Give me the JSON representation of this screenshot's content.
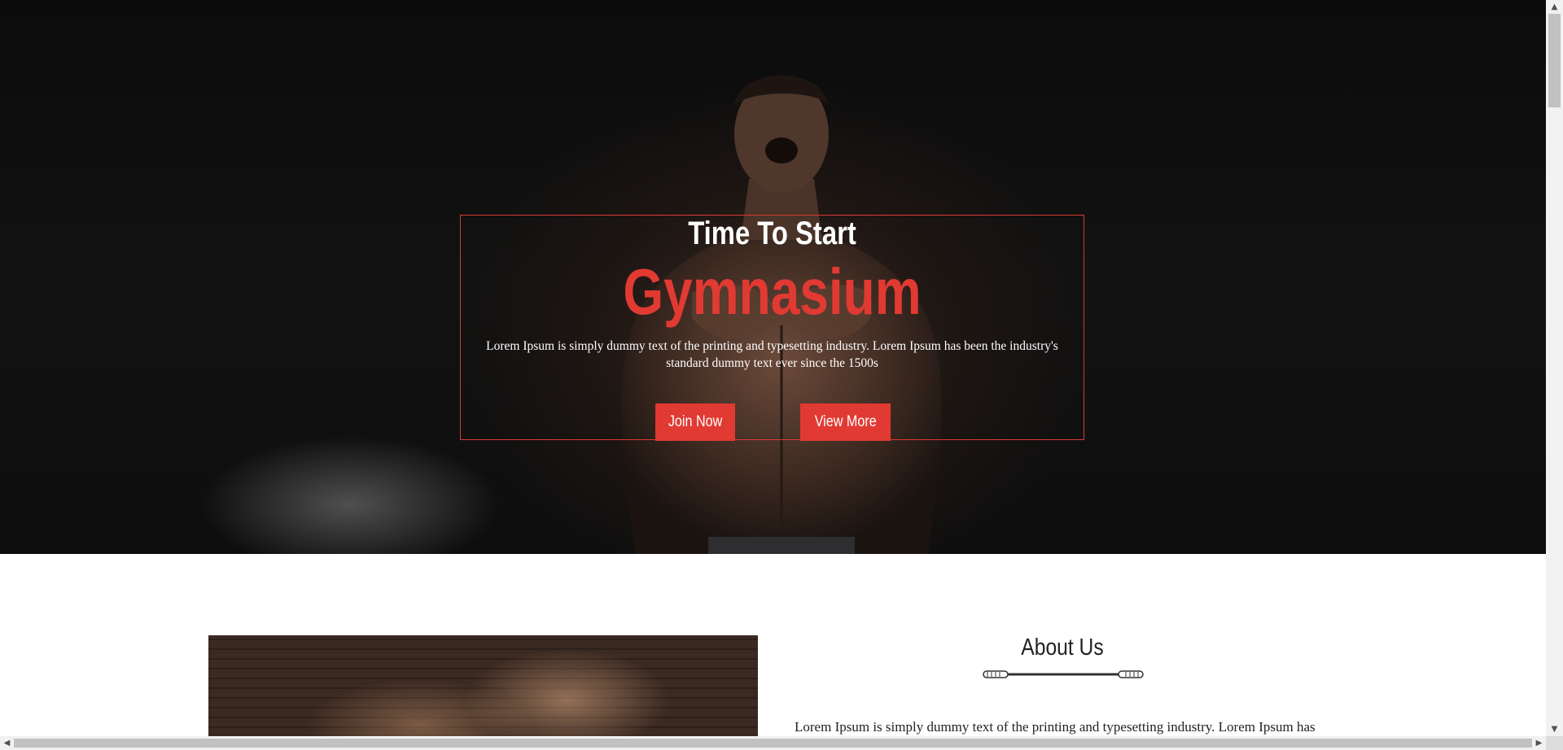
{
  "hero": {
    "pretitle": "Time To Start",
    "title": "Gymnasium",
    "text": "Lorem Ipsum is simply dummy text of the printing and typesetting industry. Lorem Ipsum has been the industry's standard dummy text ever since the 1500s",
    "buttons": {
      "join": "Join Now",
      "view": "View More"
    },
    "image": "muscular-man-shouting-icon"
  },
  "about": {
    "heading": "About Us",
    "divider_icon": "dumbbell-divider-icon",
    "text": "Lorem Ipsum is simply dummy text of the printing and typesetting industry. Lorem Ipsum has",
    "image": "group-of-people-gym-photo"
  },
  "scrollbars": {
    "up_arrow": "▲",
    "down_arrow": "▼",
    "left_arrow": "◀",
    "right_arrow": "▶"
  },
  "colors": {
    "accent": "#e03a33",
    "hero_bg": "#0e0e0e",
    "text_dark": "#222222"
  }
}
